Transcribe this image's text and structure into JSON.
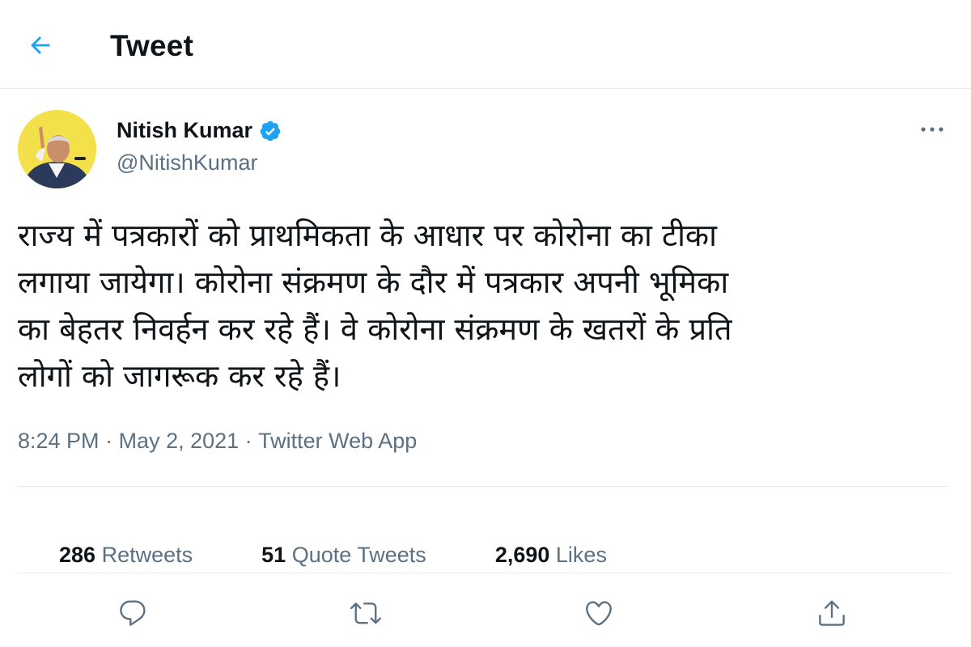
{
  "header": {
    "title": "Tweet",
    "back_icon": "arrow-left-icon"
  },
  "colors": {
    "accent": "#1da1f2",
    "text_primary": "#0f1419",
    "text_secondary": "#5b7083",
    "divider": "#e6ecf0",
    "avatar_bg": "#f4e04a"
  },
  "author": {
    "name": "Nitish Kumar",
    "handle": "@NitishKumar",
    "verified_icon": "verified-badge-icon",
    "more_icon": "more-horizontal-icon"
  },
  "tweet": {
    "text": "राज्य में पत्रकारों को प्राथमिकता के आधार पर कोरोना का टीका\nलगाया जायेगा। कोरोना संक्रमण के दौर में पत्रकार अपनी भूमिका\nका बेहतर निवर्हन कर रहे हैं। वे कोरोना संक्रमण के खतरों के प्रति\nलोगों को जागरूक कर रहे हैं।",
    "time": "8:24 PM",
    "separator": " · ",
    "date": "May 2, 2021",
    "source": "Twitter Web App"
  },
  "stats": {
    "retweets": {
      "count": "286",
      "label": " Retweets"
    },
    "quotes": {
      "count": "51",
      "label": " Quote Tweets"
    },
    "likes": {
      "count": "2,690",
      "label": " Likes"
    }
  },
  "actions": {
    "reply_icon": "reply-icon",
    "retweet_icon": "retweet-icon",
    "like_icon": "heart-icon",
    "share_icon": "share-icon"
  }
}
